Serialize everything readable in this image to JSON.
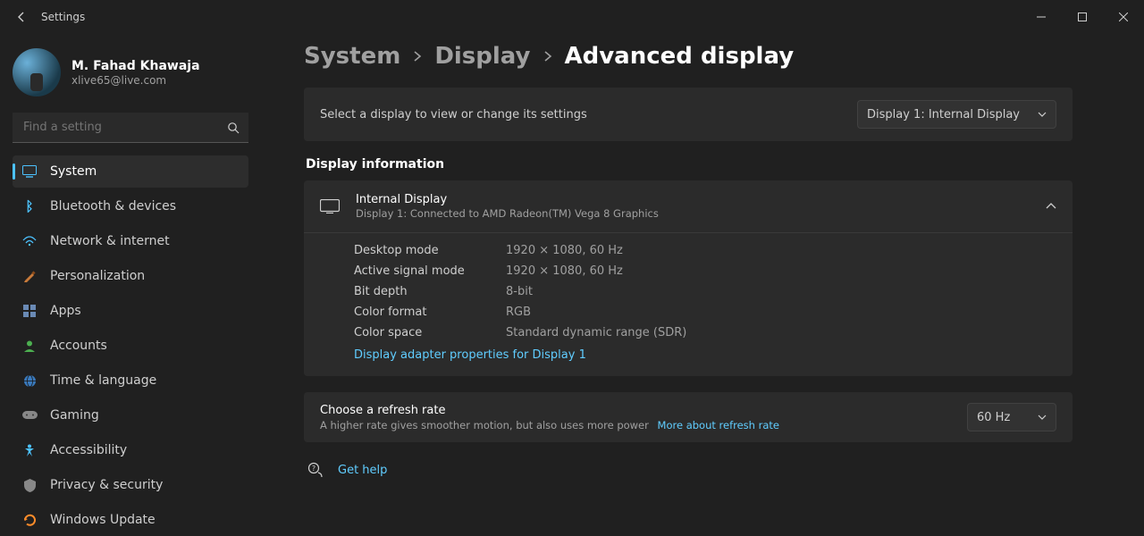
{
  "window": {
    "title": "Settings"
  },
  "profile": {
    "name": "M. Fahad Khawaja",
    "email": "xlive65@live.com"
  },
  "search": {
    "placeholder": "Find a setting"
  },
  "nav": {
    "items": [
      {
        "icon": "system-icon",
        "label": "System",
        "selected": true
      },
      {
        "icon": "bluetooth-icon",
        "label": "Bluetooth & devices"
      },
      {
        "icon": "network-icon",
        "label": "Network & internet"
      },
      {
        "icon": "personalization-icon",
        "label": "Personalization"
      },
      {
        "icon": "apps-icon",
        "label": "Apps"
      },
      {
        "icon": "accounts-icon",
        "label": "Accounts"
      },
      {
        "icon": "time-icon",
        "label": "Time & language"
      },
      {
        "icon": "gaming-icon",
        "label": "Gaming"
      },
      {
        "icon": "accessibility-icon",
        "label": "Accessibility"
      },
      {
        "icon": "privacy-icon",
        "label": "Privacy & security"
      },
      {
        "icon": "update-icon",
        "label": "Windows Update"
      }
    ]
  },
  "breadcrumb": {
    "a": "System",
    "b": "Display",
    "c": "Advanced display"
  },
  "select_panel": {
    "label": "Select a display to view or change its settings",
    "value": "Display 1: Internal Display"
  },
  "info": {
    "section_title": "Display information",
    "title": "Internal Display",
    "subtitle": "Display 1: Connected to AMD Radeon(TM) Vega 8 Graphics",
    "rows": [
      {
        "k": "Desktop mode",
        "v": "1920 × 1080, 60 Hz"
      },
      {
        "k": "Active signal mode",
        "v": "1920 × 1080, 60 Hz"
      },
      {
        "k": "Bit depth",
        "v": "8-bit"
      },
      {
        "k": "Color format",
        "v": "RGB"
      },
      {
        "k": "Color space",
        "v": "Standard dynamic range (SDR)"
      }
    ],
    "link": "Display adapter properties for Display 1"
  },
  "refresh": {
    "title": "Choose a refresh rate",
    "subtitle": "A higher rate gives smoother motion, but also uses more power",
    "link": "More about refresh rate",
    "value": "60 Hz"
  },
  "help": {
    "label": "Get help"
  },
  "icons": {
    "system": "🖥️",
    "bluetooth": "ᛒ",
    "network": "📶",
    "personalization": "🖌️",
    "apps": "🔲",
    "accounts": "👤",
    "time": "🌐",
    "gaming": "🎮",
    "accessibility": "♿",
    "privacy": "🛡️",
    "update": "🔄"
  }
}
